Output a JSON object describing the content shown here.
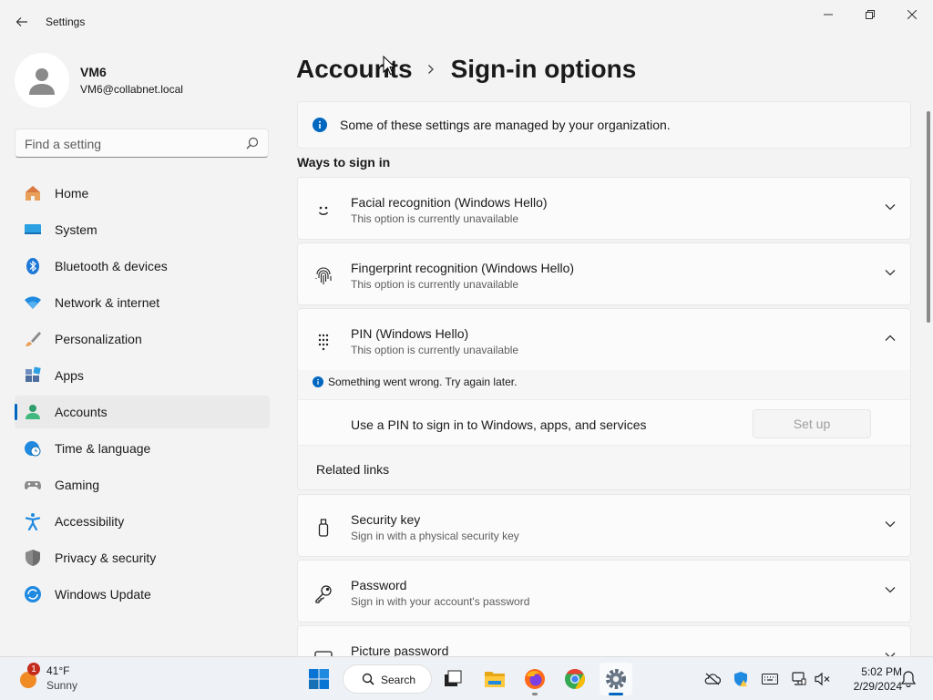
{
  "window": {
    "title": "Settings"
  },
  "profile": {
    "name": "VM6",
    "email": "VM6@collabnet.local"
  },
  "search": {
    "placeholder": "Find a setting"
  },
  "sidebar": {
    "items": [
      {
        "label": "Home",
        "icon": "home-icon",
        "active": false
      },
      {
        "label": "System",
        "icon": "system-icon",
        "active": false
      },
      {
        "label": "Bluetooth & devices",
        "icon": "bluetooth-icon",
        "active": false
      },
      {
        "label": "Network & internet",
        "icon": "wifi-icon",
        "active": false
      },
      {
        "label": "Personalization",
        "icon": "brush-icon",
        "active": false
      },
      {
        "label": "Apps",
        "icon": "apps-icon",
        "active": false
      },
      {
        "label": "Accounts",
        "icon": "accounts-icon",
        "active": true
      },
      {
        "label": "Time & language",
        "icon": "globe-clock-icon",
        "active": false
      },
      {
        "label": "Gaming",
        "icon": "gamepad-icon",
        "active": false
      },
      {
        "label": "Accessibility",
        "icon": "accessibility-icon",
        "active": false
      },
      {
        "label": "Privacy & security",
        "icon": "shield-icon",
        "active": false
      },
      {
        "label": "Windows Update",
        "icon": "update-icon",
        "active": false
      }
    ]
  },
  "breadcrumb": {
    "parent": "Accounts",
    "current": "Sign-in options"
  },
  "info": {
    "text": "Some of these settings are managed by your organization."
  },
  "ways": {
    "heading": "Ways to sign in",
    "items": [
      {
        "title": "Facial recognition (Windows Hello)",
        "subtitle": "This option is currently unavailable",
        "icon": "face-icon",
        "expanded": false
      },
      {
        "title": "Fingerprint recognition (Windows Hello)",
        "subtitle": "This option is currently unavailable",
        "icon": "fingerprint-icon",
        "expanded": false
      },
      {
        "title": "PIN (Windows Hello)",
        "subtitle": "This option is currently unavailable",
        "icon": "pin-keypad-icon",
        "expanded": true
      },
      {
        "title": "Security key",
        "subtitle": "Sign in with a physical security key",
        "icon": "usb-key-icon",
        "expanded": false
      },
      {
        "title": "Password",
        "subtitle": "Sign in with your account's password",
        "icon": "key-icon",
        "expanded": false
      },
      {
        "title": "Picture password",
        "subtitle": "",
        "icon": "picture-icon",
        "expanded": false
      }
    ]
  },
  "pin": {
    "error": "Something went wrong. Try again later.",
    "setup_text": "Use a PIN to sign in to Windows, apps, and services",
    "setup_button": "Set up",
    "related_links": "Related links"
  },
  "taskbar": {
    "weather_temp": "41°F",
    "weather_cond": "Sunny",
    "weather_badge": "1",
    "search_label": "Search",
    "time": "5:02 PM",
    "date": "2/29/2024"
  },
  "colors": {
    "accent": "#0067c0",
    "window_bg": "#f3f3f3",
    "card_bg": "#fbfbfb"
  }
}
